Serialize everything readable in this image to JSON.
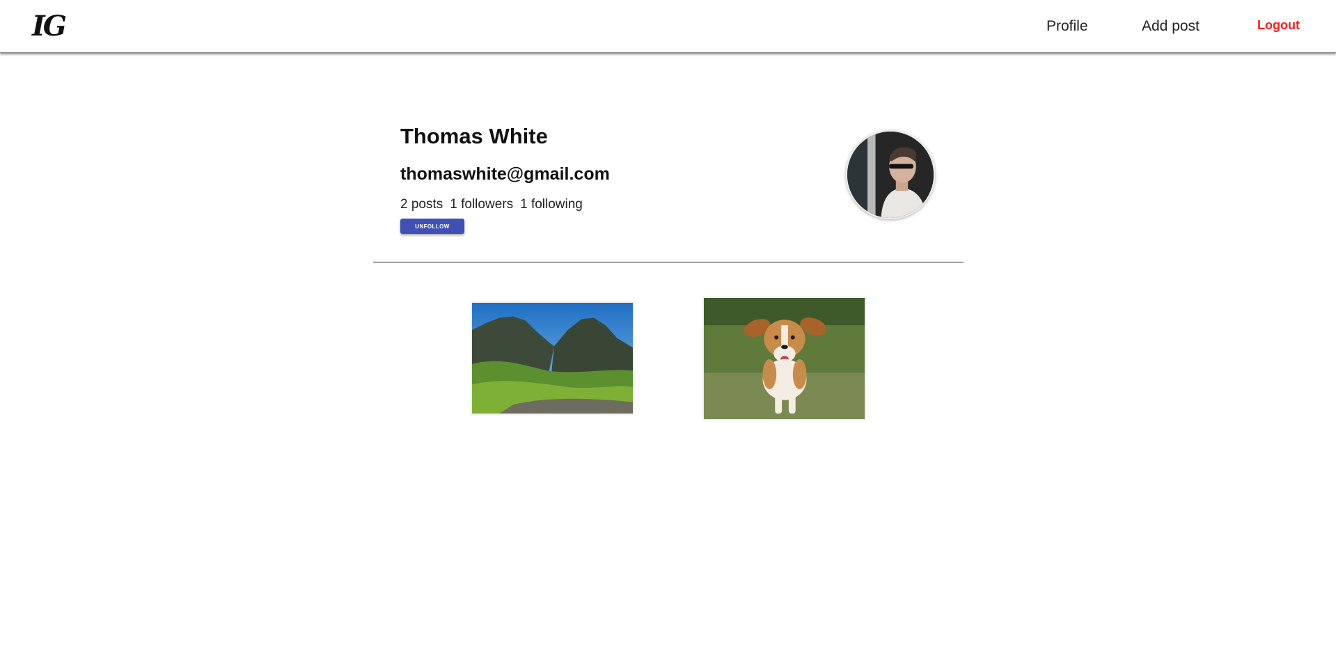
{
  "navbar": {
    "logo": "IG",
    "links": {
      "profile": "Profile",
      "add_post": "Add post",
      "logout": "Logout"
    },
    "logout_color": "#ff1a1a"
  },
  "profile": {
    "name": "Thomas White",
    "email": "thomaswhite@gmail.com",
    "stats": {
      "posts": "2 posts",
      "followers": "1 followers",
      "following": "1 following"
    },
    "unfollow_label": "UNFOLLOW",
    "button_color": "#3f51b5",
    "avatar_icon": "user-photo"
  },
  "posts": [
    {
      "subject": "mountain-landscape-photo"
    },
    {
      "subject": "running-dog-photo"
    }
  ]
}
